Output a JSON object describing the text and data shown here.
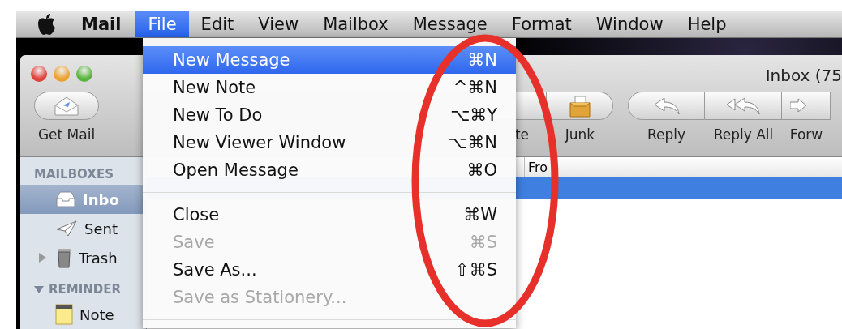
{
  "menubar": {
    "app_name": "Mail",
    "items": [
      {
        "label": "File",
        "selected": true
      },
      {
        "label": "Edit",
        "selected": false
      },
      {
        "label": "View",
        "selected": false
      },
      {
        "label": "Mailbox",
        "selected": false
      },
      {
        "label": "Message",
        "selected": false
      },
      {
        "label": "Format",
        "selected": false
      },
      {
        "label": "Window",
        "selected": false
      },
      {
        "label": "Help",
        "selected": false
      }
    ]
  },
  "file_menu": {
    "items": [
      {
        "kind": "item",
        "label": "New Message",
        "shortcut": "⌘N",
        "highlighted": true,
        "disabled": false
      },
      {
        "kind": "item",
        "label": "New Note",
        "shortcut": "^⌘N",
        "highlighted": false,
        "disabled": false
      },
      {
        "kind": "item",
        "label": "New To Do",
        "shortcut": "⌥⌘Y",
        "highlighted": false,
        "disabled": false
      },
      {
        "kind": "item",
        "label": "New Viewer Window",
        "shortcut": "⌥⌘N",
        "highlighted": false,
        "disabled": false
      },
      {
        "kind": "item",
        "label": "Open Message",
        "shortcut": "⌘O",
        "highlighted": false,
        "disabled": false
      },
      {
        "kind": "separator"
      },
      {
        "kind": "item",
        "label": "Close",
        "shortcut": "⌘W",
        "highlighted": false,
        "disabled": false
      },
      {
        "kind": "item",
        "label": "Save",
        "shortcut": "⌘S",
        "highlighted": false,
        "disabled": true
      },
      {
        "kind": "item",
        "label": "Save As...",
        "shortcut": "⇧⌘S",
        "highlighted": false,
        "disabled": false
      },
      {
        "kind": "item",
        "label": "Save as Stationery...",
        "highlighted": false,
        "disabled": true
      },
      {
        "kind": "separator"
      }
    ]
  },
  "window": {
    "title": "Inbox (75",
    "toolbar": [
      {
        "kind": "get-mail",
        "label": "Get Mail"
      },
      {
        "kind": "delete",
        "label": "te"
      },
      {
        "kind": "junk",
        "label": "Junk"
      },
      {
        "kind": "reply",
        "label": "Reply"
      },
      {
        "kind": "reply-all",
        "label": "Reply All"
      },
      {
        "kind": "forward",
        "label": "Forw"
      }
    ],
    "sidebar": {
      "sections": [
        {
          "heading": "MAILBOXES",
          "items": [
            {
              "kind": "inbox",
              "label": "Inbo",
              "selected": true
            },
            {
              "kind": "sent",
              "label": "Sent",
              "selected": false
            },
            {
              "kind": "trash",
              "label": "Trash",
              "selected": false,
              "expanded": false
            }
          ]
        },
        {
          "heading": "REMINDER",
          "expanded": true,
          "items": [
            {
              "kind": "notes",
              "label": "Note",
              "selected": false
            }
          ]
        }
      ]
    },
    "message_list": {
      "columns": [
        "Fro"
      ],
      "rows": [
        {
          "selected": true
        }
      ]
    }
  }
}
